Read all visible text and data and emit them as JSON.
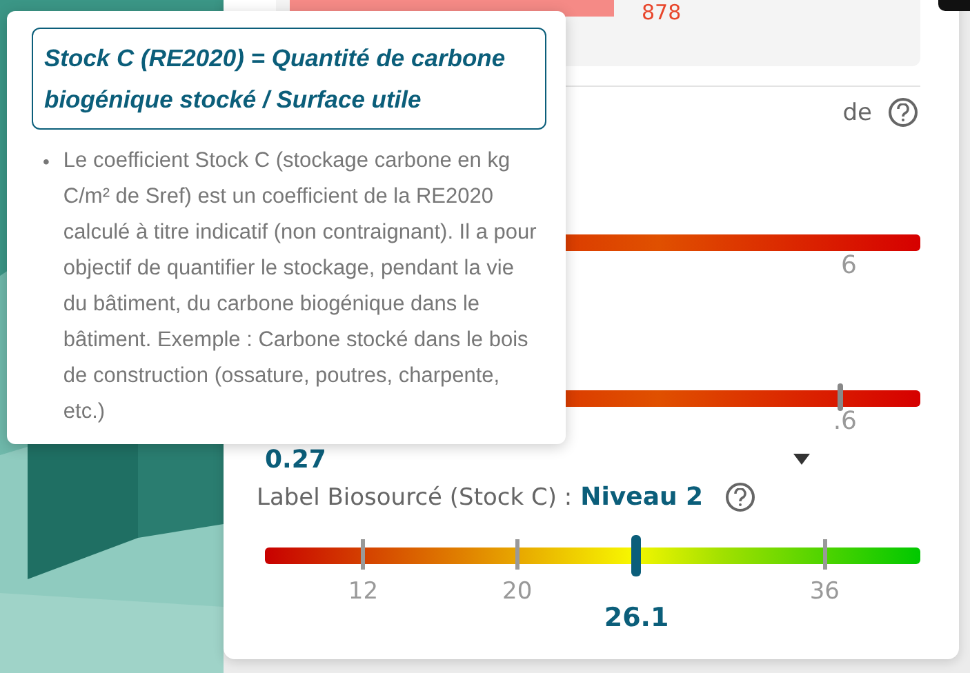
{
  "background_panel": {
    "top_value": "878",
    "heading_fragment": "de",
    "bars": [
      {
        "reading": "6"
      },
      {
        "reading": ".6",
        "level": 0.877
      }
    ],
    "value_fragment": "0.27"
  },
  "label_row": {
    "label": "Label Biosourcé (Stock C) :",
    "value": "Niveau 2"
  },
  "scale": {
    "marker": {
      "level": 0.567,
      "reading": "26.1"
    },
    "ticks": [
      {
        "label": "12",
        "level": 0.15
      },
      {
        "label": "20",
        "level": 0.385
      },
      {
        "label": "36",
        "level": 0.854
      }
    ]
  },
  "tooltip": {
    "formula": "Stock C (RE2020) = Quantité de carbone biogénique stocké / Surface utile",
    "bullets": [
      {
        "marker": "•",
        "text": "Le coefficient Stock C (stockage carbone en kg C/m² de Sref) est un coefficient de la RE2020 calculé à titre indicatif (non contraignant). Il a pour objectif de quantifier le stockage, pendant la vie du bâtiment, du carbone biogénique dans le bâtiment. Exemple : Carbone stocké dans le bois de construction (ossature, poutres, charpente, etc.)"
      }
    ]
  }
}
